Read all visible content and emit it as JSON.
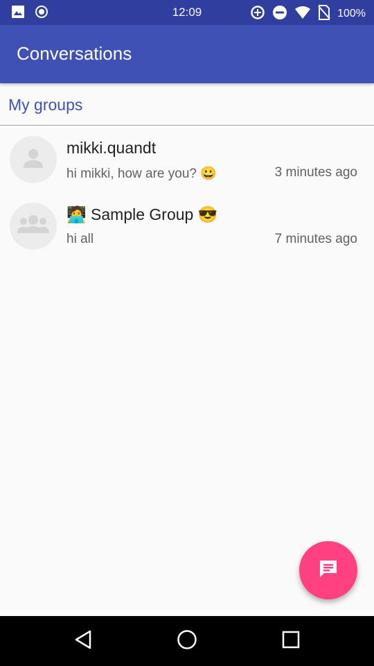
{
  "status_bar": {
    "time": "12:09",
    "battery": "100%",
    "left_icons": [
      "image-icon",
      "record-icon"
    ],
    "right_icons": [
      "data-saver-icon",
      "do-not-disturb-icon",
      "wifi-icon",
      "no-sim-icon"
    ]
  },
  "app_bar": {
    "title": "Conversations"
  },
  "section": {
    "title": "My groups"
  },
  "conversations": [
    {
      "name": "mikki.quandt",
      "preview": "hi mikki, how are you? 😀",
      "time": "3 minutes ago",
      "avatar_icon": "person-icon"
    },
    {
      "name": "🧑‍💻 Sample Group 😎",
      "preview": "hi all",
      "time": "7 minutes ago",
      "avatar_icon": "group-icon"
    }
  ],
  "fab": {
    "icon": "message-icon"
  },
  "nav_bar": {
    "buttons": [
      "back-icon",
      "home-icon",
      "recents-icon"
    ]
  },
  "colors": {
    "status_bar": "#303f9f",
    "app_bar": "#3f51b5",
    "accent": "#ff4081",
    "section_title": "#3f51b5"
  }
}
